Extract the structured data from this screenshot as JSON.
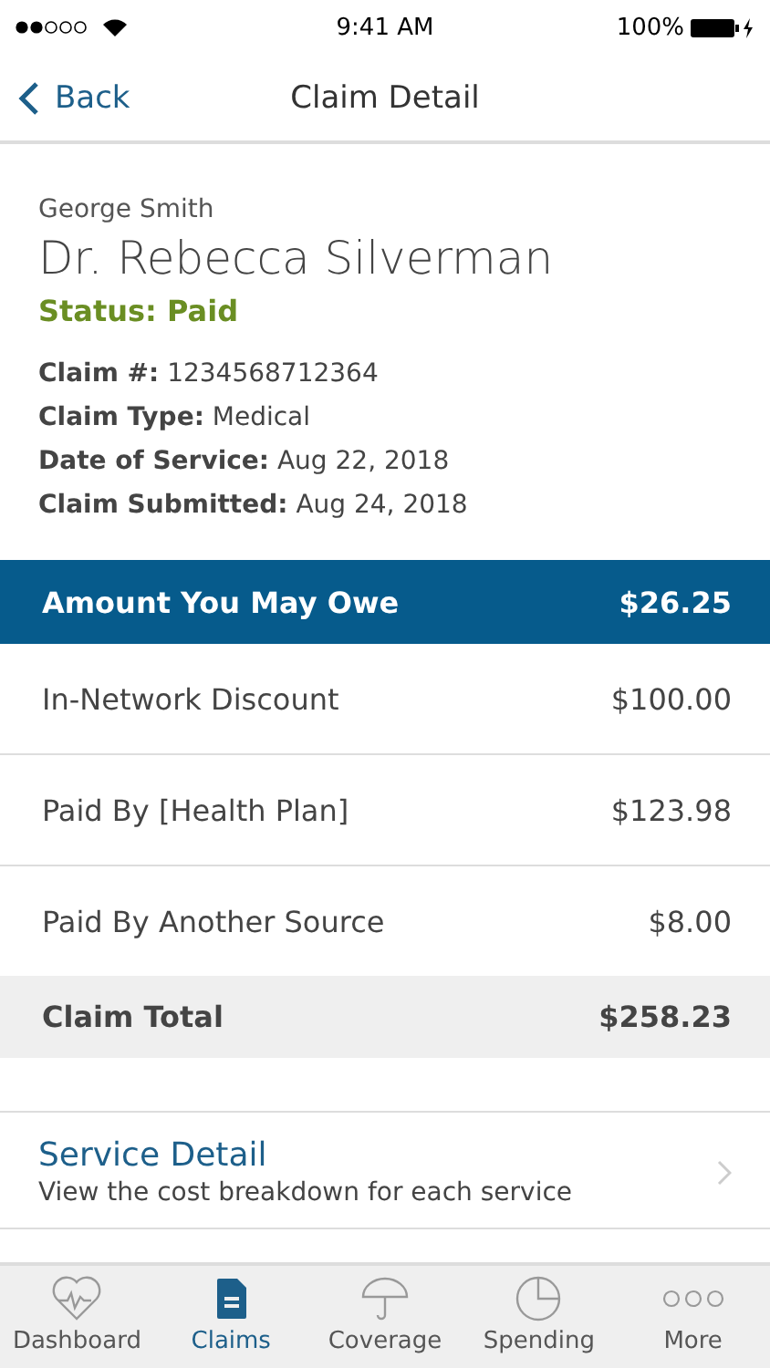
{
  "status_bar": {
    "time": "9:41 AM",
    "battery": "100%"
  },
  "nav": {
    "back": "Back",
    "title": "Claim Detail"
  },
  "claim": {
    "member": "George Smith",
    "provider": "Dr. Rebecca Silverman",
    "status": "Status: Paid",
    "details": [
      {
        "label": "Claim #:",
        "value": "1234568712364"
      },
      {
        "label": "Claim Type:",
        "value": "Medical"
      },
      {
        "label": "Date of Service:",
        "value": "Aug 22, 2018"
      },
      {
        "label": "Claim Submitted:",
        "value": "Aug 24, 2018"
      }
    ]
  },
  "costs": [
    {
      "kind": "highlight",
      "label": "Amount You May Owe",
      "amount": "$26.25"
    },
    {
      "kind": "normal",
      "label": "In-Network Discount",
      "amount": "$100.00"
    },
    {
      "kind": "normal",
      "label": "Paid By [Health Plan]",
      "amount": "$123.98"
    },
    {
      "kind": "normal",
      "label": "Paid By Another Source",
      "amount": "$8.00"
    },
    {
      "kind": "total",
      "label": "Claim Total",
      "amount": "$258.23"
    }
  ],
  "service_detail": {
    "title": "Service Detail",
    "subtitle": "View the cost breakdown for each service"
  },
  "tabs": [
    {
      "kind": "dashboard",
      "label": "Dashboard",
      "selected": false
    },
    {
      "kind": "claims",
      "label": "Claims",
      "selected": true
    },
    {
      "kind": "coverage",
      "label": "Coverage",
      "selected": false
    },
    {
      "kind": "spending",
      "label": "Spending",
      "selected": false
    },
    {
      "kind": "more",
      "label": "More",
      "selected": false
    }
  ]
}
